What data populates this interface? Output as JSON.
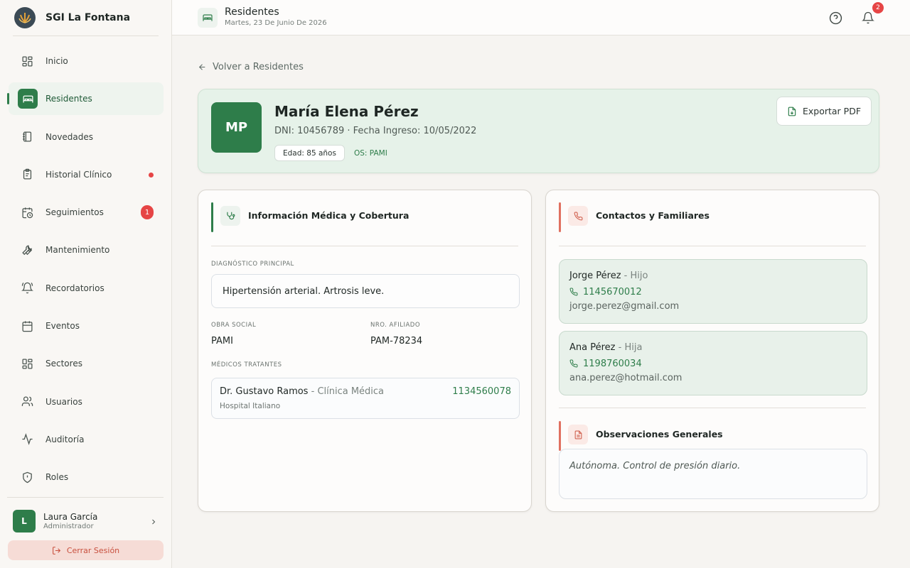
{
  "app": {
    "name": "SGI La Fontana"
  },
  "sidebar": {
    "items": [
      {
        "label": "Inicio",
        "icon": "grid-icon"
      },
      {
        "label": "Residentes",
        "icon": "bed-icon",
        "active": true
      },
      {
        "label": "Novedades",
        "icon": "notebook-icon"
      },
      {
        "label": "Historial Clínico",
        "icon": "clipboard-icon",
        "dot": true
      },
      {
        "label": "Seguimientos",
        "icon": "calendar-clock-icon",
        "badge": "1"
      },
      {
        "label": "Mantenimiento",
        "icon": "wrench-icon"
      },
      {
        "label": "Recordatorios",
        "icon": "bell-ring-icon"
      },
      {
        "label": "Eventos",
        "icon": "calendar-icon"
      },
      {
        "label": "Sectores",
        "icon": "grid-icon"
      },
      {
        "label": "Usuarios",
        "icon": "users-icon"
      },
      {
        "label": "Auditoría",
        "icon": "activity-icon"
      },
      {
        "label": "Roles",
        "icon": "shield-icon"
      }
    ],
    "user": {
      "initial": "L",
      "name": "Laura García",
      "role": "Administrador"
    },
    "logout_label": "Cerrar Sesión"
  },
  "header": {
    "title": "Residentes",
    "date": "Martes, 23 De Junio De 2026",
    "notifications_count": "2"
  },
  "back_link": "Volver a Residentes",
  "resident": {
    "initials": "MP",
    "name": "María Elena Pérez",
    "meta": "DNI: 10456789 · Fecha Ingreso: 10/05/2022",
    "age_chip": "Edad: 85 años",
    "os_chip": "OS: PAMI",
    "export_label": "Exportar PDF"
  },
  "medical": {
    "title": "Información Médica y Cobertura",
    "diagnosis_label": "DIAGNÓSTICO PRINCIPAL",
    "diagnosis": "Hipertensión arterial. Artrosis leve.",
    "obra_social_label": "OBRA SOCIAL",
    "obra_social": "PAMI",
    "afiliado_label": "NRO. AFILIADO",
    "afiliado": "PAM-78234",
    "doctors_label": "MÉDICOS TRATANTES",
    "doctor": {
      "name": "Dr. Gustavo Ramos",
      "specialty": "Clínica Médica",
      "hospital": "Hospital Italiano",
      "phone": "1134560078"
    }
  },
  "contacts": {
    "title": "Contactos y Familiares",
    "list": [
      {
        "name": "Jorge Pérez",
        "relation": "Hijo",
        "phone": "1145670012",
        "email": "jorge.perez@gmail.com"
      },
      {
        "name": "Ana Pérez",
        "relation": "Hija",
        "phone": "1198760034",
        "email": "ana.perez@hotmail.com"
      }
    ],
    "observations_title": "Observaciones Generales",
    "observations": "Autónoma. Control de presión diario."
  },
  "colors": {
    "accent": "#2e7d4a",
    "danger": "#e64545",
    "contact_accent": "#e07060"
  }
}
